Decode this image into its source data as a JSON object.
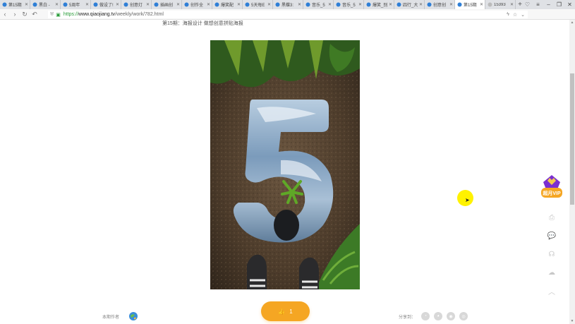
{
  "tabs": [
    {
      "label": "第15期",
      "active": false
    },
    {
      "label": "黑白 -",
      "active": false
    },
    {
      "label": "5周年",
      "active": false
    },
    {
      "label": "做设了!",
      "active": false
    },
    {
      "label": "创意灯",
      "active": false
    },
    {
      "label": "插画创",
      "active": false
    },
    {
      "label": "创作全",
      "active": false
    },
    {
      "label": "爆笑配",
      "active": false
    },
    {
      "label": "5天每E",
      "active": false
    },
    {
      "label": "黑蝶3:",
      "active": false
    },
    {
      "label": "音乐_5",
      "active": false
    },
    {
      "label": "音乐_5",
      "active": false
    },
    {
      "label": "爆笑_别",
      "active": false
    },
    {
      "label": "四行_大",
      "active": false
    },
    {
      "label": "创意创",
      "active": false
    },
    {
      "label": "第15期",
      "active": true
    },
    {
      "label": "15393",
      "active": false
    }
  ],
  "address_bar": {
    "scheme": "https://",
    "host": "www.qiaojiang.tv",
    "path": "/weekly/work/782.html"
  },
  "page": {
    "title": "第15期：海报设计 做想创意拼贴海报",
    "bottom_left_label": "本期作者",
    "like_count": "1",
    "share_label": "分享到："
  },
  "side_tools": {
    "vip_label": "超月VIP"
  },
  "colors": {
    "accent": "#f5a623",
    "cursor_highlight": "#fff200",
    "secure": "#2a9d3a"
  }
}
